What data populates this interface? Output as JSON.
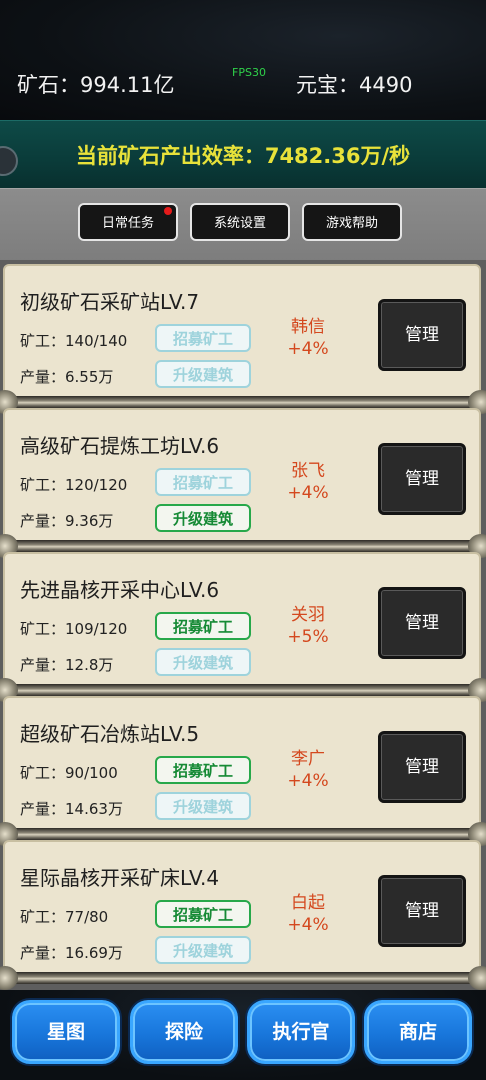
{
  "header": {
    "ore": "矿石：994.11亿",
    "fps": "FPS30",
    "yuanbao": "元宝：4490",
    "rate": "当前矿石产出效率：7482.36万/秒"
  },
  "menu": {
    "daily": "日常任务",
    "settings": "系统设置",
    "help": "游戏帮助"
  },
  "cards": [
    {
      "title": "初级矿石采矿站LV.7",
      "workers": "矿工：140/140",
      "output": "产量：6.55万",
      "recruit": "招募矿工",
      "upgrade": "升级建筑",
      "general": "韩信",
      "bonus": "+4%",
      "manage": "管理",
      "recruit_enabled": false,
      "upgrade_enabled": false
    },
    {
      "title": "高级矿石提炼工坊LV.6",
      "workers": "矿工：120/120",
      "output": "产量：9.36万",
      "recruit": "招募矿工",
      "upgrade": "升级建筑",
      "general": "张飞",
      "bonus": "+4%",
      "manage": "管理",
      "recruit_enabled": false,
      "upgrade_enabled": true
    },
    {
      "title": "先进晶核开采中心LV.6",
      "workers": "矿工：109/120",
      "output": "产量：12.8万",
      "recruit": "招募矿工",
      "upgrade": "升级建筑",
      "general": "关羽",
      "bonus": "+5%",
      "manage": "管理",
      "recruit_enabled": true,
      "upgrade_enabled": false
    },
    {
      "title": "超级矿石冶炼站LV.5",
      "workers": "矿工：90/100",
      "output": "产量：14.63万",
      "recruit": "招募矿工",
      "upgrade": "升级建筑",
      "general": "李广",
      "bonus": "+4%",
      "manage": "管理",
      "recruit_enabled": true,
      "upgrade_enabled": false
    },
    {
      "title": "星际晶核开采矿床LV.4",
      "workers": "矿工：77/80",
      "output": "产量：16.69万",
      "recruit": "招募矿工",
      "upgrade": "升级建筑",
      "general": "白起",
      "bonus": "+4%",
      "manage": "管理",
      "recruit_enabled": true,
      "upgrade_enabled": false
    }
  ],
  "nav": {
    "star_map": "星图",
    "explore": "探险",
    "executive": "执行官",
    "shop": "商店"
  }
}
